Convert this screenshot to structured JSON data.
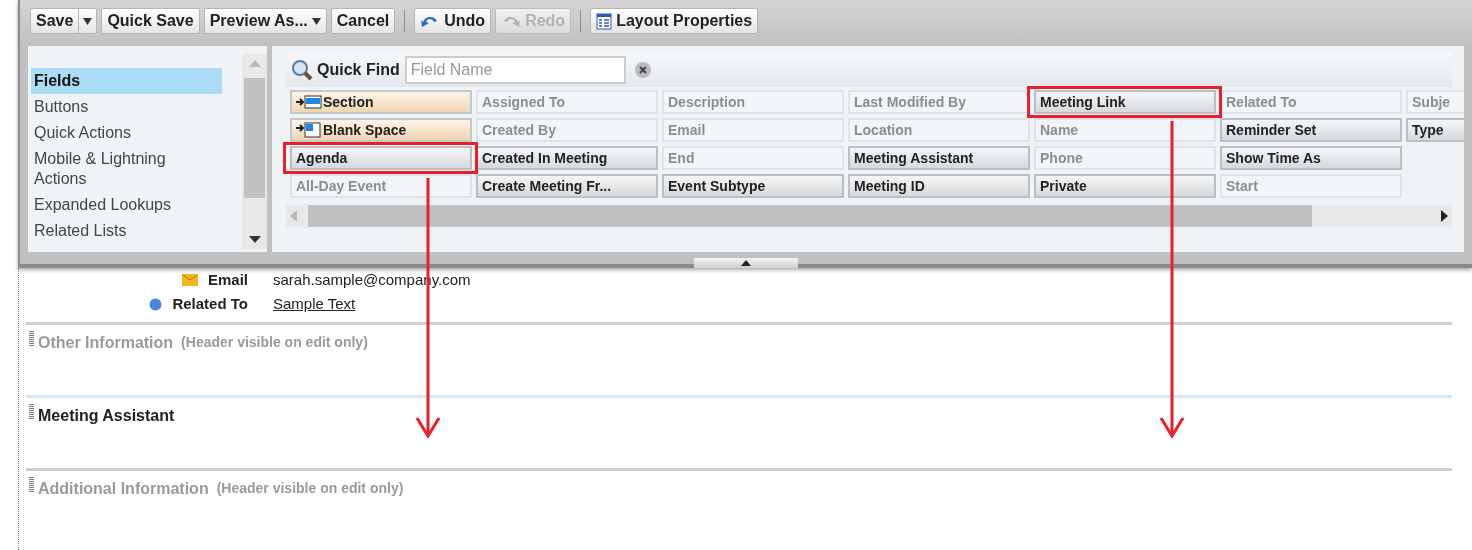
{
  "toolbar": [
    {
      "label": "Save",
      "kind": "split",
      "disabled": false
    },
    {
      "label": "Quick Save",
      "kind": "plain",
      "disabled": false
    },
    {
      "label": "Preview As...",
      "kind": "menu",
      "disabled": false
    },
    {
      "label": "Cancel",
      "kind": "plain",
      "disabled": false
    },
    {
      "label": "Undo",
      "kind": "undo",
      "disabled": false
    },
    {
      "label": "Redo",
      "kind": "redo",
      "disabled": true
    },
    {
      "label": "Layout Properties",
      "kind": "properties",
      "disabled": false
    }
  ],
  "sidebar": {
    "items": [
      {
        "label": "Fields",
        "selected": true
      },
      {
        "label": "Buttons",
        "selected": false
      },
      {
        "label": "Quick Actions",
        "selected": false
      },
      {
        "label": "Mobile & Lightning Actions",
        "selected": false
      },
      {
        "label": "Expanded Lookups",
        "selected": false
      },
      {
        "label": "Related Lists",
        "selected": false
      }
    ]
  },
  "quick_find": {
    "label": "Quick Find",
    "placeholder": "Field Name"
  },
  "field_rows": [
    [
      {
        "label": "Section",
        "kind": "section",
        "used": false,
        "highlighted": false
      },
      {
        "label": "Assigned To",
        "kind": "field",
        "used": true,
        "highlighted": false
      },
      {
        "label": "Description",
        "kind": "field",
        "used": true,
        "highlighted": false
      },
      {
        "label": "Last Modified By",
        "kind": "field",
        "used": true,
        "highlighted": false
      },
      {
        "label": "Meeting Link",
        "kind": "field",
        "used": false,
        "highlighted": true
      },
      {
        "label": "Related To",
        "kind": "field",
        "used": true,
        "highlighted": false
      },
      {
        "label": "Subje",
        "kind": "field",
        "used": true,
        "highlighted": false
      }
    ],
    [
      {
        "label": "Blank Space",
        "kind": "blank",
        "used": false,
        "highlighted": false
      },
      {
        "label": "Created By",
        "kind": "field",
        "used": true,
        "highlighted": false
      },
      {
        "label": "Email",
        "kind": "field",
        "used": true,
        "highlighted": false
      },
      {
        "label": "Location",
        "kind": "field",
        "used": true,
        "highlighted": false
      },
      {
        "label": "Name",
        "kind": "field",
        "used": true,
        "highlighted": false
      },
      {
        "label": "Reminder Set",
        "kind": "field",
        "used": false,
        "highlighted": false
      },
      {
        "label": "Type",
        "kind": "field",
        "used": false,
        "highlighted": false
      }
    ],
    [
      {
        "label": "Agenda",
        "kind": "field",
        "used": false,
        "highlighted": true
      },
      {
        "label": "Created In Meeting",
        "kind": "field",
        "used": false,
        "highlighted": false
      },
      {
        "label": "End",
        "kind": "field",
        "used": true,
        "highlighted": false
      },
      {
        "label": "Meeting Assistant",
        "kind": "field",
        "used": false,
        "highlighted": false
      },
      {
        "label": "Phone",
        "kind": "field",
        "used": true,
        "highlighted": false
      },
      {
        "label": "Show Time As",
        "kind": "field",
        "used": false,
        "highlighted": false
      }
    ],
    [
      {
        "label": "All-Day Event",
        "kind": "field",
        "used": true,
        "highlighted": false
      },
      {
        "label": "Create Meeting Fr...",
        "kind": "field",
        "used": false,
        "highlighted": false
      },
      {
        "label": "Event Subtype",
        "kind": "field",
        "used": false,
        "highlighted": false
      },
      {
        "label": "Meeting ID",
        "kind": "field",
        "used": false,
        "highlighted": false
      },
      {
        "label": "Private",
        "kind": "field",
        "used": false,
        "highlighted": false
      },
      {
        "label": "Start",
        "kind": "field",
        "used": true,
        "highlighted": false
      }
    ]
  ],
  "detail_rows": [
    {
      "label": "Email",
      "value": "sarah.sample@company.com",
      "kind": "email"
    },
    {
      "label": "Related To",
      "value": "Sample Text",
      "kind": "link"
    }
  ],
  "sections": [
    {
      "title": "Other Information",
      "note": "(Header visible on edit only)",
      "muted": true
    },
    {
      "title": "Meeting Assistant",
      "muted": false
    },
    {
      "title": "Additional Information",
      "note": "(Header visible on edit only)",
      "muted": true
    }
  ]
}
